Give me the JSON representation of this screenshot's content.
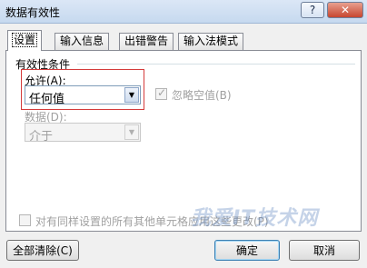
{
  "window": {
    "title": "数据有效性",
    "help_glyph": "?",
    "close_glyph": "✕"
  },
  "tabs": [
    {
      "label": "设置"
    },
    {
      "label": "输入信息"
    },
    {
      "label": "出错警告"
    },
    {
      "label": "输入法模式"
    }
  ],
  "settings": {
    "section_title": "有效性条件",
    "allow_label": "允许(A):",
    "allow_value": "任何值",
    "ignore_blank_label": "忽略空值(B)",
    "data_label": "数据(D):",
    "data_value": "介于",
    "apply_all_label": "对有同样设置的所有其他单元格应用这些更改(P)"
  },
  "buttons": {
    "clear_all": "全部清除(C)",
    "ok": "确定",
    "cancel": "取消"
  },
  "watermark": "我爱IT技术网",
  "colors": {
    "highlight": "#d43b3b"
  }
}
